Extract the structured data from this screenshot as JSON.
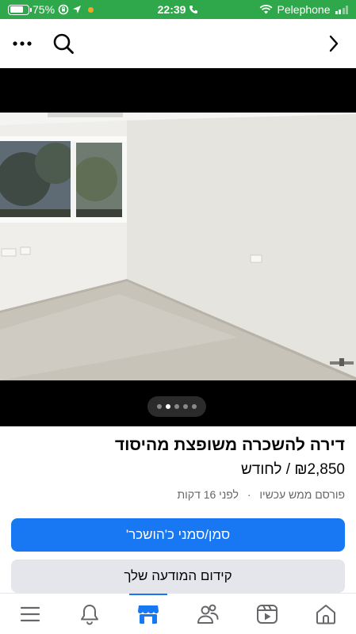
{
  "status_bar": {
    "battery_percent": "75%",
    "battery_level": 0.75,
    "time": "22:39",
    "carrier": "Pelephone"
  },
  "top_nav": {
    "more_icon": "more-horizontal-icon",
    "search_icon": "search-icon",
    "forward_icon": "chevron-right-icon"
  },
  "photo": {
    "pager": {
      "count": 5,
      "active_index": 1
    }
  },
  "listing": {
    "title": "דירה להשכרה משופצת מהיסוד",
    "price": "₪2,850 / לחודש",
    "posted": "לפני 16 דקות",
    "separator": "·",
    "posted_note": "פורסם ממש עכשיו"
  },
  "actions": {
    "mark_rented_label": "סמן/סמני כ'הושכר'",
    "boost_label": "קידום המודעה שלך"
  },
  "tab_bar": {
    "tabs": [
      {
        "name": "menu",
        "icon": "hamburger-menu-icon"
      },
      {
        "name": "notifications",
        "icon": "bell-icon"
      },
      {
        "name": "marketplace",
        "icon": "marketplace-shop-icon",
        "active": true
      },
      {
        "name": "groups",
        "icon": "groups-icon"
      },
      {
        "name": "video",
        "icon": "video-play-icon"
      },
      {
        "name": "home",
        "icon": "home-icon"
      }
    ]
  },
  "colors": {
    "status_bar": "#2ea84a",
    "primary": "#1877f2",
    "secondary_button": "#e4e6eb",
    "muted_text": "#65676b"
  }
}
